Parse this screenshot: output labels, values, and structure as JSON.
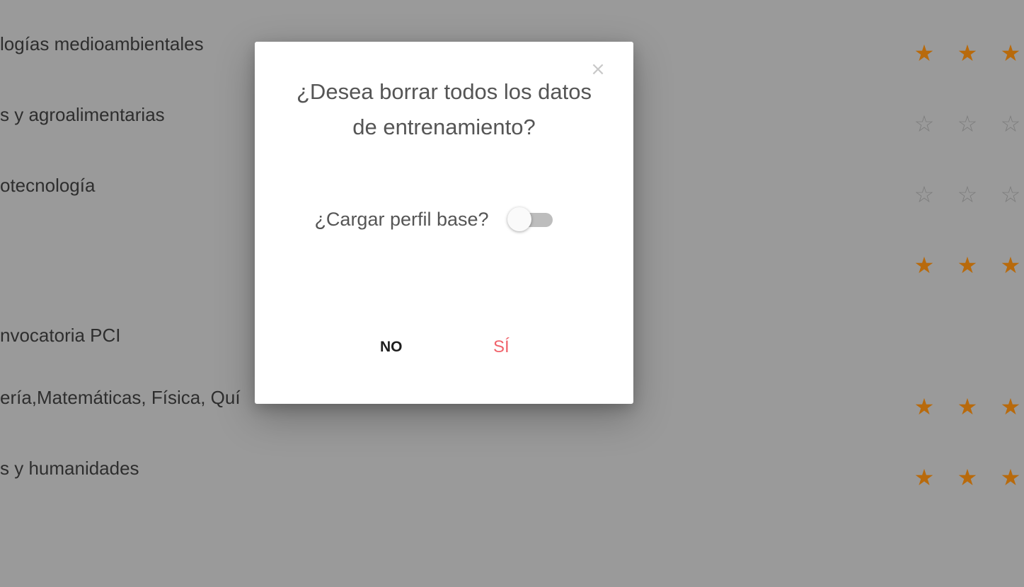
{
  "background_rows": [
    {
      "label": "logías medioambientales",
      "stars": [
        true,
        true,
        true
      ]
    },
    {
      "label": "s y agroalimentarias",
      "stars": [
        false,
        false,
        false
      ]
    },
    {
      "label": "otecnología",
      "stars": [
        false,
        false,
        false
      ]
    },
    {
      "label": "",
      "stars": [
        true,
        true,
        true
      ]
    },
    {
      "label": "nvocatoria PCI",
      "stars": null
    },
    {
      "label": "ería,Matemáticas, Física, Quí",
      "stars": [
        true,
        true,
        true
      ]
    },
    {
      "label": "s y humanidades",
      "stars": [
        true,
        true,
        true
      ]
    }
  ],
  "star_glyphs": {
    "filled": "★",
    "empty": "☆"
  },
  "dialog": {
    "close_glyph": "×",
    "title": "¿Desea borrar todos los datos de entrenamiento?",
    "toggle_label": "¿Cargar perfil base?",
    "toggle_on": false,
    "no_label": "NO",
    "yes_label": "SÍ"
  },
  "colors": {
    "overlay": "#9a9a9a",
    "star_filled": "#b86a0c",
    "yes_accent": "#f0636b"
  }
}
